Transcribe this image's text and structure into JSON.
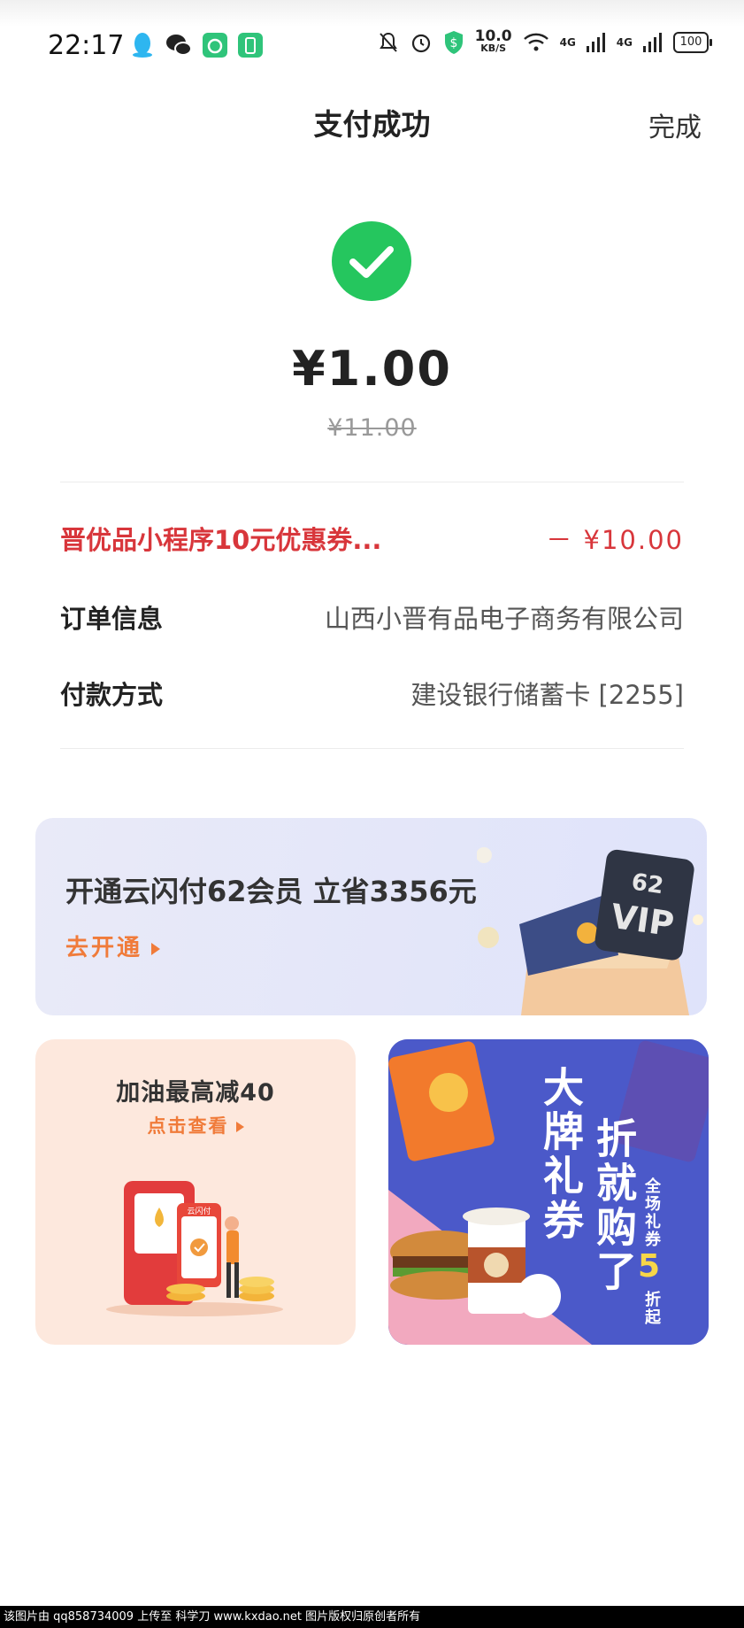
{
  "status_bar": {
    "time": "22:17",
    "net_speed_value": "10.0",
    "net_speed_unit": "KB/S",
    "signal1": "4G",
    "signal2": "4G",
    "battery": "100",
    "left_icons": [
      "qq-icon",
      "wechat-icon",
      "app-icon",
      "battery-saver-icon"
    ],
    "right_icons": [
      "mute-icon",
      "alarm-icon",
      "shield-icon",
      "wifi-icon"
    ]
  },
  "nav": {
    "title": "支付成功",
    "done": "完成"
  },
  "payment": {
    "amount": "¥1.00",
    "original": "¥11.00"
  },
  "details": {
    "coupon_label": "晋优品小程序10元优惠券...",
    "coupon_value": "－ ¥10.00",
    "order_label": "订单信息",
    "order_value": "山西小晋有品电子商务有限公司",
    "method_label": "付款方式",
    "method_value": "建设银行储蓄卡 [2255]"
  },
  "vip_banner": {
    "title": "开通云闪付62会员 立省3356元",
    "cta": "去开通",
    "badge_top": "62",
    "badge_bottom": "VIP"
  },
  "fuel_card": {
    "title": "加油最高减40",
    "cta": "点击查看",
    "phone_label": "云闪付"
  },
  "brand_card": {
    "line1": "大牌礼券",
    "line2": "折就购了",
    "small1": "全场礼券",
    "number": "5",
    "small2": "折起"
  },
  "watermark": "该图片由 qq858734009 上传至 科学刀 www.kxdao.net 图片版权归原创者所有",
  "colors": {
    "success": "#25c65e",
    "discount_red": "#d8363b",
    "accent_orange": "#f07b3a",
    "brand_blue": "#4b59c9"
  }
}
